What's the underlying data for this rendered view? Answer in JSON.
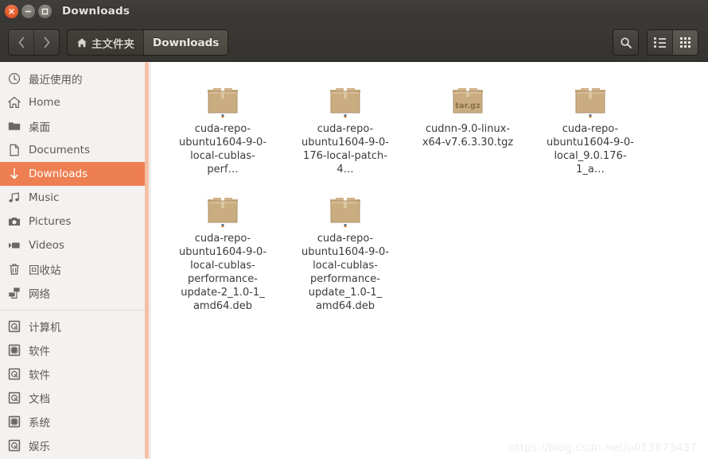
{
  "window": {
    "title": "Downloads",
    "buttons": {
      "close": "close-button",
      "minimize": "minimize-button",
      "maximize": "maximize-button"
    }
  },
  "toolbar": {
    "back_label": "‹",
    "forward_label": "›",
    "path": [
      {
        "label": "主文件夹",
        "icon": "home-icon",
        "active": false
      },
      {
        "label": "Downloads",
        "icon": "",
        "active": true
      }
    ],
    "search_label": "search-icon",
    "list_view_label": "list-view-icon",
    "icon_view_label": "icon-view-icon"
  },
  "sidebar": {
    "groups": [
      {
        "items": [
          {
            "label": "最近使用的",
            "icon": "clock-icon",
            "selected": false
          },
          {
            "label": "Home",
            "icon": "home-icon",
            "selected": false
          },
          {
            "label": "桌面",
            "icon": "folder-icon",
            "selected": false
          },
          {
            "label": "Documents",
            "icon": "document-icon",
            "selected": false
          },
          {
            "label": "Downloads",
            "icon": "download-icon",
            "selected": true
          },
          {
            "label": "Music",
            "icon": "music-icon",
            "selected": false
          },
          {
            "label": "Pictures",
            "icon": "camera-icon",
            "selected": false
          },
          {
            "label": "Videos",
            "icon": "video-icon",
            "selected": false
          },
          {
            "label": "回收站",
            "icon": "trash-icon",
            "selected": false
          },
          {
            "label": "网络",
            "icon": "network-icon",
            "selected": false
          }
        ]
      },
      {
        "items": [
          {
            "label": "计算机",
            "icon": "disk-icon",
            "selected": false
          },
          {
            "label": "软件",
            "icon": "chip-disk-icon",
            "selected": false
          },
          {
            "label": "软件",
            "icon": "disk-icon",
            "selected": false
          },
          {
            "label": "文档",
            "icon": "disk-icon",
            "selected": false
          },
          {
            "label": "系统",
            "icon": "chip-disk-icon",
            "selected": false
          },
          {
            "label": "娱乐",
            "icon": "disk-icon",
            "selected": false
          }
        ]
      }
    ]
  },
  "files": [
    {
      "name": "cuda-repo-\nubuntu1604-9-0-\nlocal-cublas-perf…",
      "icon": "package-icon",
      "badge": ""
    },
    {
      "name": "cuda-repo-\nubuntu1604-9-0-\n176-local-patch-4…",
      "icon": "package-icon",
      "badge": ""
    },
    {
      "name": "cudnn-9.0-linux-\nx64-v7.6.3.30.tgz",
      "icon": "archive-icon",
      "badge": "tar.gz"
    },
    {
      "name": "cuda-repo-\nubuntu1604-9-0-\nlocal_9.0.176-1_a…",
      "icon": "package-icon",
      "badge": ""
    },
    {
      "name": "cuda-repo-\nubuntu1604-9-0-\nlocal-cublas-\nperformance-\nupdate-2_1.0-1_\namd64.deb",
      "icon": "package-icon",
      "badge": ""
    },
    {
      "name": "cuda-repo-\nubuntu1604-9-0-\nlocal-cublas-\nperformance-\nupdate_1.0-1_\namd64.deb",
      "icon": "package-icon",
      "badge": ""
    }
  ],
  "watermark": {
    "text": "https://blog.csdn.net/u013673437"
  },
  "colors": {
    "titlebar": "#3d3b37",
    "toolbar": "#383631",
    "sidebar_bg": "#f4f2f0",
    "selection": "#ee7f52",
    "scrollbar": "#f2bfa4",
    "main_bg": "#ffffff",
    "text": "#5c5955",
    "package_icon": "#c9ad81"
  }
}
